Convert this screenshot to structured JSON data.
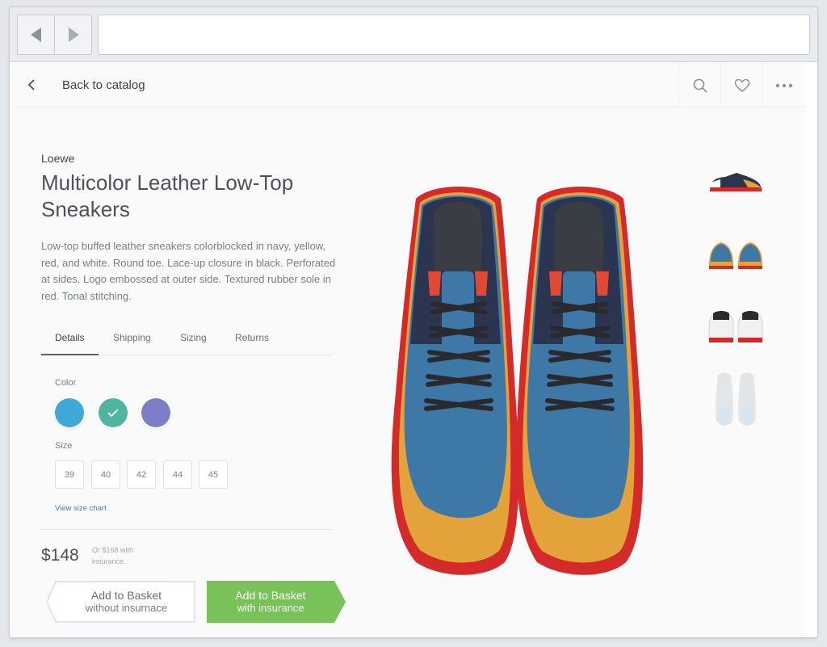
{
  "page": {
    "back_label": "Back to catalog"
  },
  "product": {
    "brand": "Loewe",
    "title": "Multicolor Leather Low-Top Sneakers",
    "description": "Low-top buffed leather sneakers colorblocked in navy, yellow, red, and white. Round toe. Lace-up closure in black. Perforated at sides. Logo embossed at outer side. Textured rubber sole in red. Tonal stitching."
  },
  "tabs": [
    {
      "label": "Details",
      "active": true
    },
    {
      "label": "Shipping",
      "active": false
    },
    {
      "label": "Sizing",
      "active": false
    },
    {
      "label": "Returns",
      "active": false
    }
  ],
  "options": {
    "color_label": "Color",
    "colors": [
      {
        "hex": "#3ea8d6",
        "selected": false
      },
      {
        "hex": "#4db5a0",
        "selected": true
      },
      {
        "hex": "#7a7fc7",
        "selected": false
      }
    ],
    "size_label": "Size",
    "sizes": [
      "39",
      "40",
      "42",
      "44",
      "45"
    ],
    "size_chart_link": "View size chart"
  },
  "pricing": {
    "price": "$148",
    "insurance_note": "Or $168 with insurance."
  },
  "actions": {
    "basket_plain": {
      "line1": "Add to Basket",
      "line2": "without insurnace"
    },
    "basket_insured": {
      "line1": "Add to Basket",
      "line2": "with insurance"
    }
  },
  "theme": {
    "accent_green": "#79c25a",
    "link_blue": "#3b7fc4"
  },
  "icons": {
    "back": "chevron-left-icon",
    "search": "search-icon",
    "favorite": "heart-icon",
    "more": "more-dots-icon"
  }
}
